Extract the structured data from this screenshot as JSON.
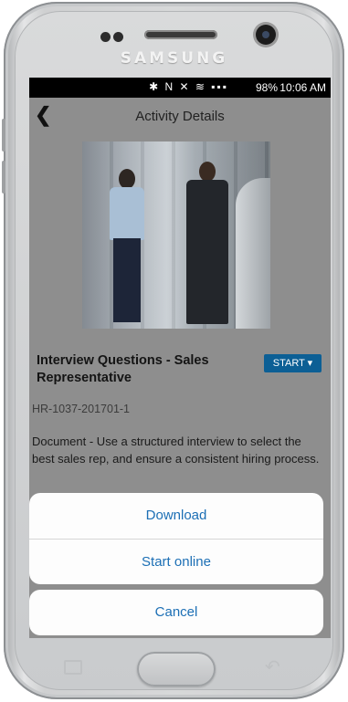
{
  "device": {
    "brand": "SAMSUNG"
  },
  "statusbar": {
    "icons": "✱ N ✕ ≋ ▪▪▪",
    "battery": "98%",
    "time": "10:06 AM"
  },
  "header": {
    "title": "Activity Details"
  },
  "activity": {
    "title": "Interview Questions - Sales Representative",
    "start_label": "START ▾",
    "code": "HR-1037-201701-1",
    "description": "Document - Use a structured interview to select the best sales rep, and ensure a consistent hiring process."
  },
  "action_sheet": {
    "download_label": "Download",
    "start_online_label": "Start online",
    "cancel_label": "Cancel"
  },
  "colors": {
    "accent": "#1c6fb5",
    "start_button": "#0c5f95"
  }
}
